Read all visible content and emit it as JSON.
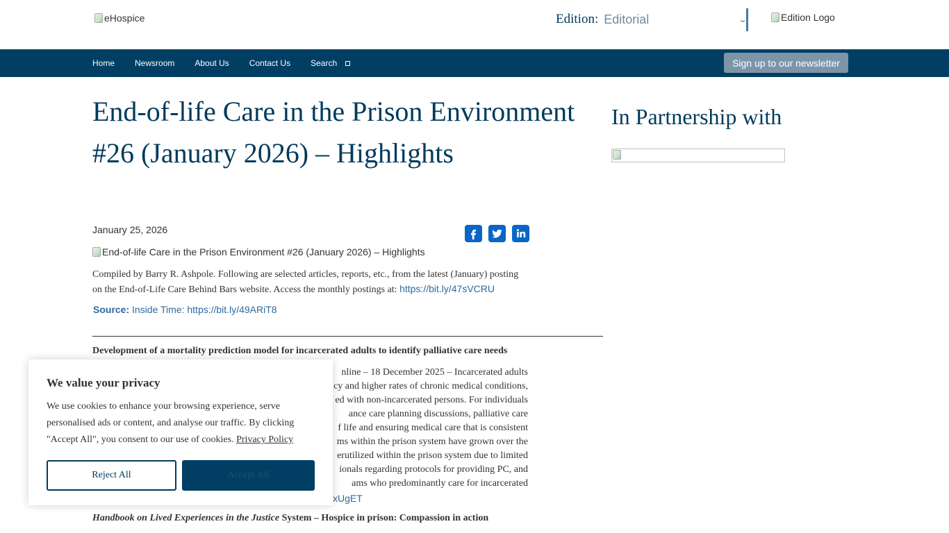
{
  "header": {
    "logo_alt": "eHospice",
    "edition_label": "Edition:",
    "edition_value": "Editorial",
    "edition_logo_alt": "Edition Logo"
  },
  "nav": {
    "items": [
      "Home",
      "Newsroom",
      "About Us",
      "Contact Us",
      "Search"
    ],
    "newsletter_label": "Sign up to our newsletter"
  },
  "article": {
    "title": "End-of-life Care in the Prison Environment #26 (January 2026) – Highlights",
    "date": "January 25, 2026",
    "image_alt": "End-of-life Care in the Prison Environment #26 (January 2026) – Highlights",
    "intro_line1": "Compiled by Barry R. Ashpole.  Following are selected articles, reports, etc., from the latest (January) posting",
    "intro_line2": "on the End-of-Life Care Behind Bars website. Access the monthly postings at: ",
    "intro_link": "https://bit.ly/47sVCRU",
    "source_label": "Source:",
    "source_text": " Inside Time: https://bit.ly/49ARiT8",
    "section_heading": "Development of a mortality prediction model for incarcerated adults to identify palliative care needs",
    "section_lines": [
      "nline – 18 December 2025 – Incarcerated adults",
      "cy and higher rates of chronic medical conditions,",
      "ed with non-incarcerated persons. For individuals",
      "ance care planning discussions, palliative care",
      "f life and ensuring medical care that is consistent",
      "ms within the prison system have grown over the",
      "erutilized within the prison system due to limited",
      "ionals regarding protocols for providing PC, and",
      "ams who predominantly care for incarcerated"
    ],
    "section_link_fragment": "xUgET",
    "next_heading_italic": "Handbook on Lived Experiences in the Justice",
    "next_heading_rest": " System – Hospice in prison: Compassion in action"
  },
  "share": {
    "icons": [
      "facebook-icon",
      "twitter-icon",
      "linkedin-icon"
    ],
    "color": "#0866c6"
  },
  "sidebar": {
    "title": "In Partnership with"
  },
  "cookie": {
    "title": "We value your privacy",
    "text": "We use cookies to enhance your browsing experience, serve personalised ads or content, and analyse our traffic. By clicking \"Accept All\", you consent to our use of cookies. ",
    "policy_link": "Privacy Policy",
    "reject_label": "Reject All",
    "accept_label": "Accept All"
  },
  "colors": {
    "brand_navy": "#003f63",
    "heading": "#003a5c",
    "link": "#2d6a9f",
    "newsletter_button": "#7d95a8"
  }
}
